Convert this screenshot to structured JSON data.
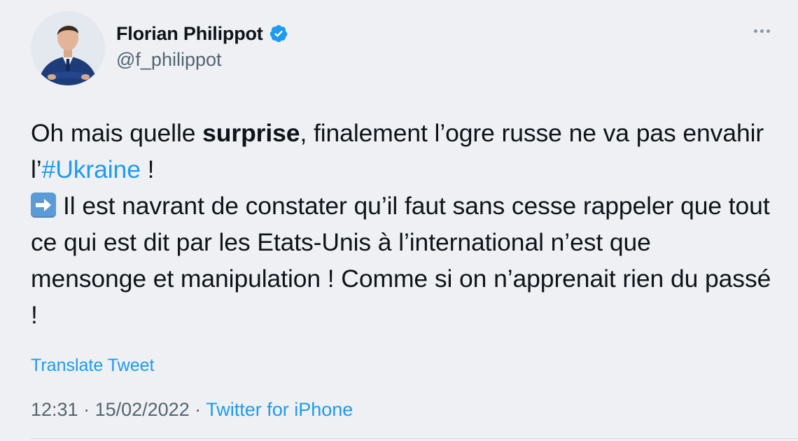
{
  "author": {
    "display_name": "Florian Philippot",
    "handle": "@f_philippot",
    "verified": true
  },
  "tweet": {
    "text_part1": "Oh mais quelle ",
    "text_bold": "surprise",
    "text_part2": ", finalement l’ogre russe ne va pas envahir l’",
    "hashtag": "#Ukraine",
    "text_part3": " !",
    "text_part4": "Il est navrant de constater qu’il faut sans cesse rappeler que tout ce qui est dit par les Etats-Unis à l’international n’est que mensonge et manipulation ! Comme si on n’apprenait rien du passé !"
  },
  "translate_label": "Translate Tweet",
  "meta": {
    "time": "12:31",
    "separator": " · ",
    "date": "15/02/2022",
    "source": "Twitter for iPhone"
  },
  "icons": {
    "verified": "verified-badge-icon",
    "more": "more-options-icon",
    "arrow": "right-arrow-emoji-icon"
  },
  "colors": {
    "accent": "#1d9bf0",
    "secondary_text": "#536471",
    "background": "#eef0f3"
  }
}
